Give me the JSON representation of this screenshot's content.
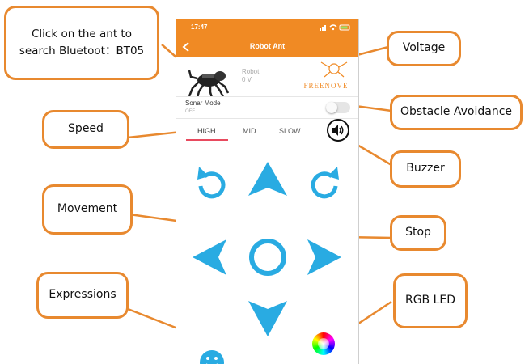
{
  "phone": {
    "time": "17:47",
    "title": "Robot Ant",
    "back_icon": "chevron-left-icon",
    "robot_label": "Robot",
    "voltage": "0 V",
    "brand": "FREENOVE",
    "sonar_label": "Sonar Mode",
    "sonar_state": "OFF",
    "speed": {
      "high": "HIGH",
      "mid": "MID",
      "slow": "SLOW",
      "selected": "HIGH"
    },
    "colors": {
      "accent": "#f08a24",
      "control": "#29abe2",
      "bg": "#ffffff"
    }
  },
  "callouts": {
    "ant": [
      "Click on the ant to",
      "search Bluetoot：BT05"
    ],
    "voltage": "Voltage",
    "obstacle": "Obstacle Avoidance",
    "speed": "Speed",
    "buzzer": "Buzzer",
    "movement": "Movement",
    "stop": "Stop",
    "expressions": "Expressions",
    "rgb": "RGB LED"
  }
}
